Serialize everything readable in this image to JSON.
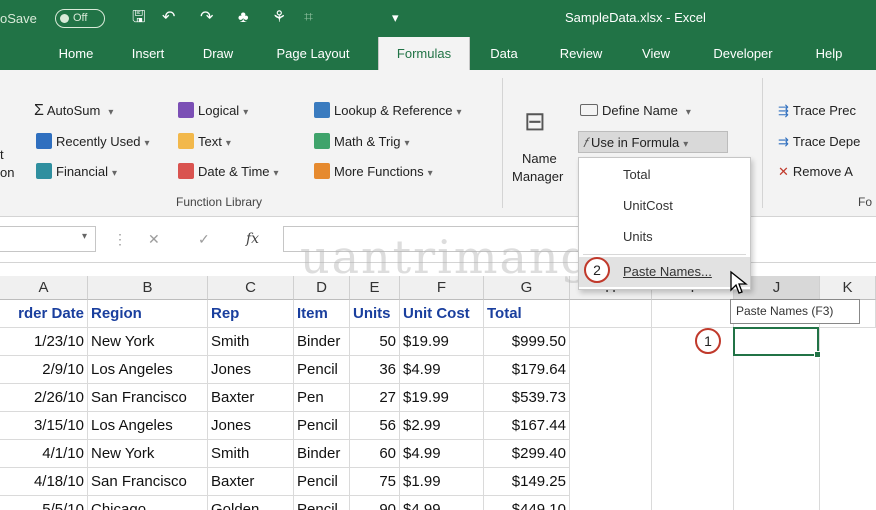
{
  "titlebar": {
    "autosave_label": "oSave",
    "autosave_state": "Off",
    "file_title": "SampleData.xlsx  -  Excel"
  },
  "tabs": [
    "Home",
    "Insert",
    "Draw",
    "Page Layout",
    "Formulas",
    "Data",
    "Review",
    "View",
    "Developer",
    "Help"
  ],
  "active_tab": "Formulas",
  "ribbon": {
    "left_cut_1": "t",
    "left_cut_2": "on",
    "autosum": "AutoSum",
    "recently_used": "Recently Used",
    "financial": "Financial",
    "logical": "Logical",
    "text": "Text",
    "date_time": "Date & Time",
    "lookup_reference": "Lookup & Reference",
    "math_trig": "Math & Trig",
    "more_functions": "More Functions",
    "function_library_label": "Function Library",
    "name_manager_1": "Name",
    "name_manager_2": "Manager",
    "define_name": "Define Name",
    "use_in_formula": "Use in Formula",
    "trace_precedents": "Trace Prec",
    "trace_dependents": "Trace Depe",
    "remove_arrows": "Remove A",
    "formula_auditing_label": "Fo"
  },
  "formula_bar": {
    "fx": "fx"
  },
  "columns": [
    "A",
    "B",
    "C",
    "D",
    "E",
    "F",
    "G",
    "H",
    "I",
    "J",
    "K"
  ],
  "headers": [
    "rder Date",
    "Region",
    "Rep",
    "Item",
    "Units",
    "Unit Cost",
    "Total"
  ],
  "rows": [
    [
      "1/23/10",
      "New York",
      "Smith",
      "Binder",
      "50",
      "$19.99",
      "$999.50"
    ],
    [
      "2/9/10",
      "Los Angeles",
      "Jones",
      "Pencil",
      "36",
      "$4.99",
      "$179.64"
    ],
    [
      "2/26/10",
      "San Francisco",
      "Baxter",
      "Pen",
      "27",
      "$19.99",
      "$539.73"
    ],
    [
      "3/15/10",
      "Los Angeles",
      "Jones",
      "Pencil",
      "56",
      "$2.99",
      "$167.44"
    ],
    [
      "4/1/10",
      "New York",
      "Smith",
      "Binder",
      "60",
      "$4.99",
      "$299.40"
    ],
    [
      "4/18/10",
      "San Francisco",
      "Baxter",
      "Pencil",
      "75",
      "$1.99",
      "$149.25"
    ],
    [
      "5/5/10",
      "Chicago",
      "Golden",
      "Pencil",
      "90",
      "$4.99",
      "$449.10"
    ]
  ],
  "dropdown": {
    "items": [
      "Total",
      "UnitCost",
      "Units",
      "Paste Names..."
    ]
  },
  "badges": {
    "one": "1",
    "two": "2"
  },
  "tooltip": "Paste Names (F3)",
  "watermark": "uantrimang",
  "colors": {
    "excel_green": "#217346",
    "header_blue": "#1a3f9e",
    "badge_red": "#c0392b"
  }
}
